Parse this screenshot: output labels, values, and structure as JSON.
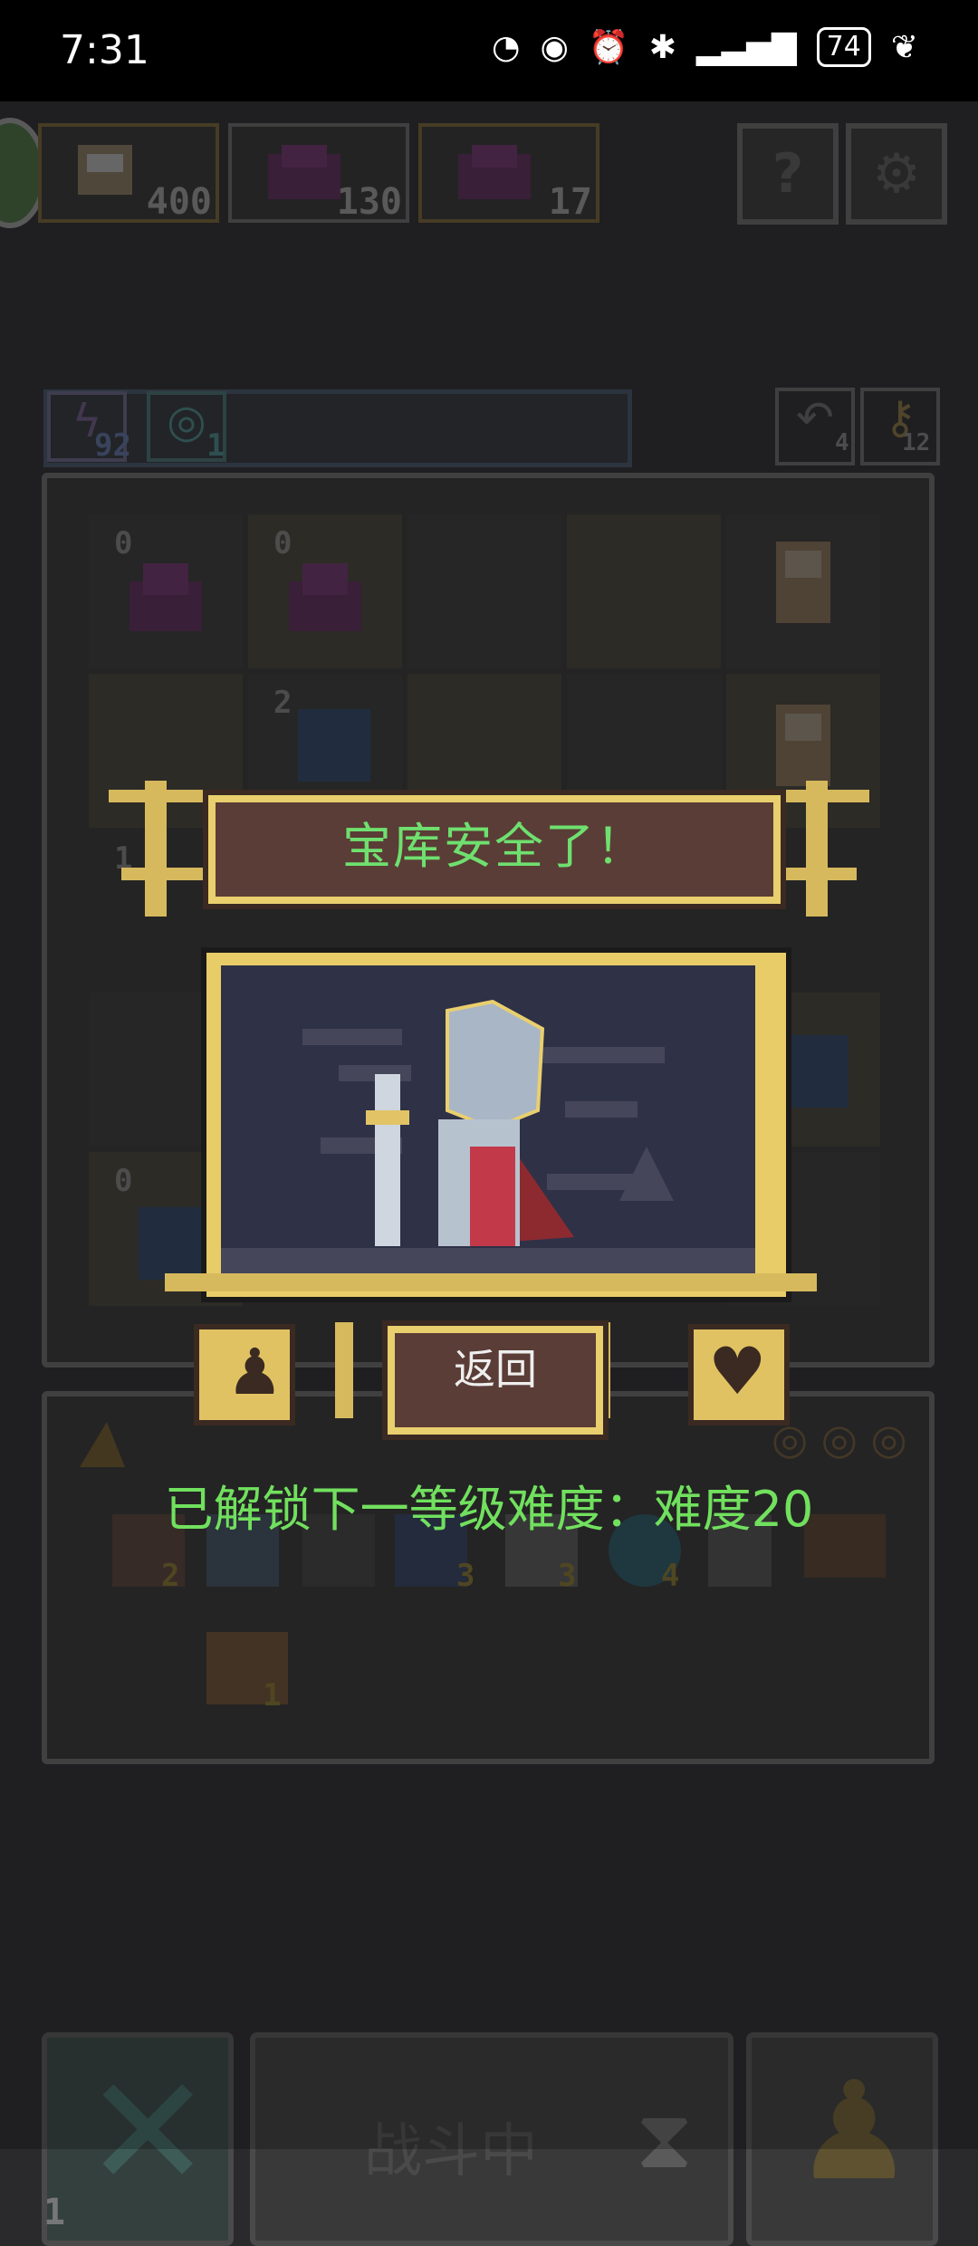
{
  "status_bar": {
    "time": "7:31",
    "battery": "74"
  },
  "top_bar": {
    "enemy_slots": [
      {
        "count": "400"
      },
      {
        "count": "130"
      },
      {
        "count": "17"
      }
    ],
    "help_label": "?",
    "settings_icon": "gear-icon"
  },
  "resources": {
    "energy": "92",
    "cycles": "1",
    "undo": "4",
    "keys": "12"
  },
  "board_numbers": {
    "cell_a": "0",
    "cell_b": "0",
    "cell_c": "2",
    "cell_d": "1",
    "cell_e": "0"
  },
  "inventory": {
    "item_counts": [
      "2",
      "3",
      "3",
      "4",
      "1"
    ]
  },
  "popup": {
    "title": "宝库安全了！",
    "return_label": "返回",
    "unlock_message": "已解锁下一等级难度：难度20"
  },
  "bottom": {
    "battle_label": "战斗中",
    "cancel_count": "1"
  },
  "colors": {
    "gold": "#d7b95d",
    "banner_bg": "#5a3d36",
    "highlight_green": "#71e05e"
  }
}
